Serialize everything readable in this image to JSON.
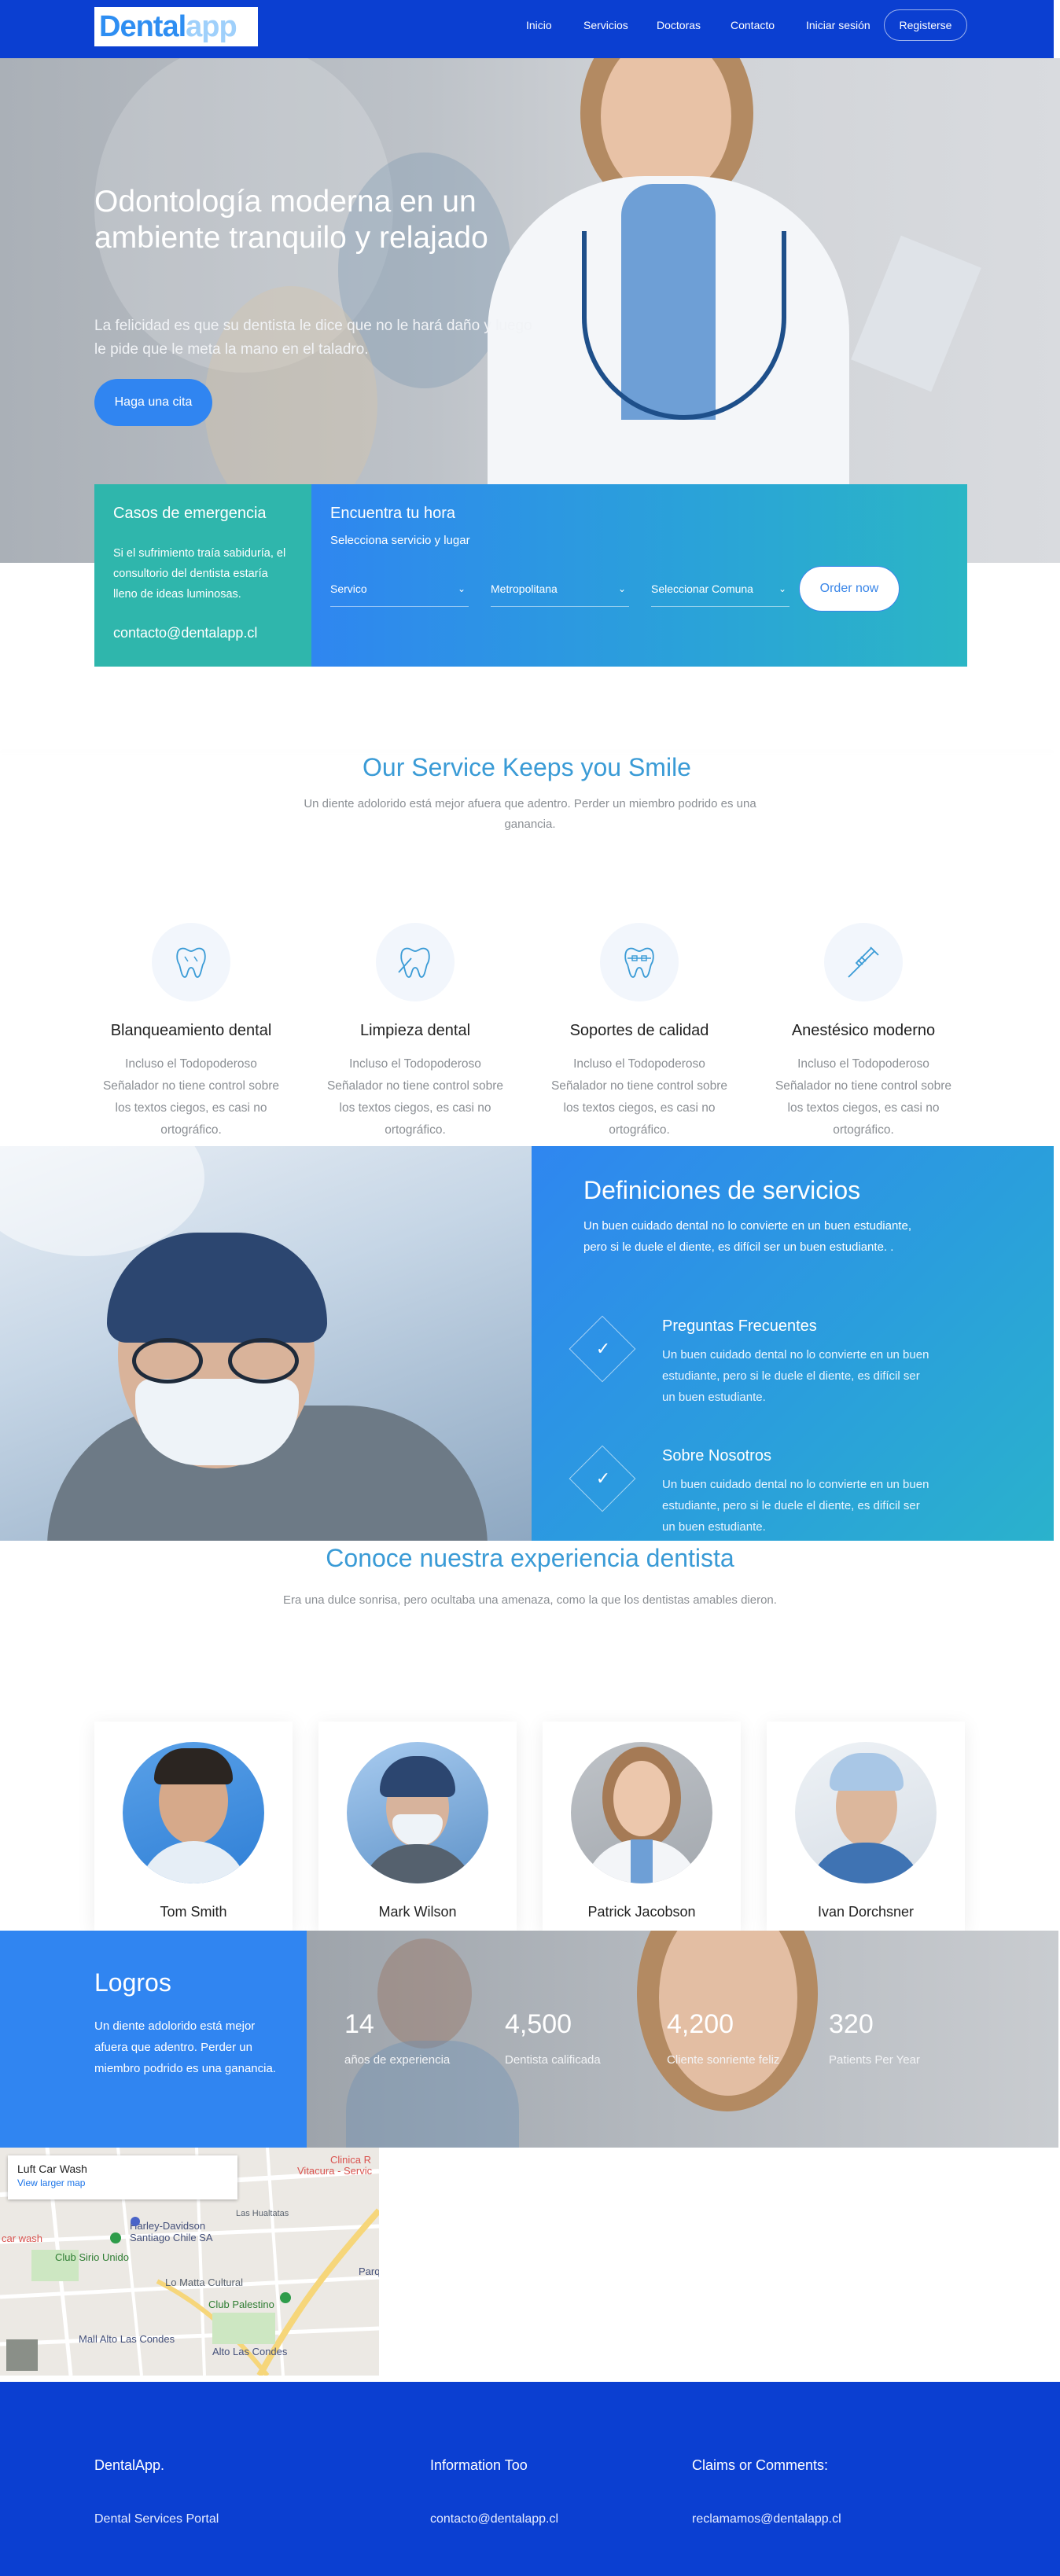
{
  "nav": {
    "logo_part1": "Dental",
    "logo_part2": "app",
    "links": [
      "Inicio",
      "Servicios",
      "Doctoras",
      "Contacto",
      "Iniciar sesión"
    ],
    "register": "Registerse"
  },
  "hero": {
    "title": "Odontología moderna en un ambiente tranquilo y relajado",
    "subtitle": "La felicidad es que su dentista le dice que no le hará daño y luego le pide que le meta la mano en el taladro.",
    "cta": "Haga una cita"
  },
  "emergency": {
    "title": "Casos de emergencia",
    "text": "Si el sufrimiento traía sabiduría, el consultorio del dentista estaría lleno de ideas luminosas.",
    "email": "contacto@dentalapp.cl"
  },
  "booking": {
    "title": "Encuentra tu hora",
    "subtitle": "Selecciona servicio y lugar",
    "selects": [
      "Servico",
      "Metropolitana",
      "Seleccionar Comuna"
    ],
    "order": "Order now"
  },
  "services": {
    "title": "Our Service Keeps you Smile",
    "subtitle": "Un diente adolorido está mejor afuera que adentro. Perder un miembro podrido es una ganancia.",
    "items": [
      {
        "name": "Blanqueamiento dental",
        "desc": "Incluso el Todopoderoso Señalador no tiene control sobre los textos ciegos, es casi no ortográfico.",
        "icon": "tooth-icon"
      },
      {
        "name": "Limpieza dental",
        "desc": "Incluso el Todopoderoso Señalador no tiene control sobre los textos ciegos, es casi no ortográfico.",
        "icon": "tooth-cleaning-icon"
      },
      {
        "name": "Soportes de calidad",
        "desc": "Incluso el Todopoderoso Señalador no tiene control sobre los textos ciegos, es casi no ortográfico.",
        "icon": "braces-icon"
      },
      {
        "name": "Anestésico moderno",
        "desc": "Incluso el Todopoderoso Señalador no tiene control sobre los textos ciegos, es casi no ortográfico.",
        "icon": "syringe-icon"
      }
    ]
  },
  "definitions": {
    "title": "Definiciones de servicios",
    "text": "Un buen cuidado dental no lo convierte en un buen estudiante, pero si le duele el diente, es difícil ser un buen estudiante. .",
    "items": [
      {
        "title": "Preguntas Frecuentes",
        "text": "Un buen cuidado dental no lo convierte en un buen estudiante, pero si le duele el diente, es difícil ser un buen estudiante."
      },
      {
        "title": "Sobre Nosotros",
        "text": "Un buen cuidado dental no lo convierte en un buen estudiante, pero si le duele el diente, es difícil ser un buen estudiante."
      }
    ]
  },
  "team": {
    "title": "Conoce nuestra experiencia dentista",
    "subtitle": "Era una dulce sonrisa, pero ocultaba una amenaza, como la que los dentistas amables dieron.",
    "members": [
      "Tom Smith",
      "Mark Wilson",
      "Patrick Jacobson",
      "Ivan Dorchsner"
    ]
  },
  "achievements": {
    "title": "Logros",
    "text": "Un diente adolorido está mejor afuera que adentro. Perder un miembro podrido es una ganancia.",
    "stats": [
      {
        "value": "14",
        "label": "años de experiencia"
      },
      {
        "value": "4,500",
        "label": "Dentista calificada"
      },
      {
        "value": "4,200",
        "label": "Cliente sonriente feliz"
      },
      {
        "value": "320",
        "label": "Patients Per Year"
      }
    ]
  },
  "map": {
    "place": "Luft Car Wash",
    "link": "View larger map",
    "labels": [
      "Clinica R",
      "Vitacura - Servic",
      "Harley-Davidson Santiago Chile SA",
      "Club Sirio Unido",
      "Lo Matta Cultural",
      "Club Palestino",
      "Mall Alto Las Condes",
      "Alto Las Condes",
      "Parq de La",
      "Las Hualtatas",
      "car wash"
    ]
  },
  "footer": {
    "cols": [
      {
        "title": "DentalApp.",
        "text": "Dental Services Portal"
      },
      {
        "title": "Information Too",
        "text": "contacto@dentalapp.cl"
      },
      {
        "title": "Claims or Comments:",
        "text": "reclamamos@dentalapp.cl"
      }
    ]
  },
  "colors": {
    "nav_bg": "#0b3fd1",
    "accent": "#3085f1",
    "teal": "#2fb6ac",
    "heading": "#3a9bd6"
  }
}
